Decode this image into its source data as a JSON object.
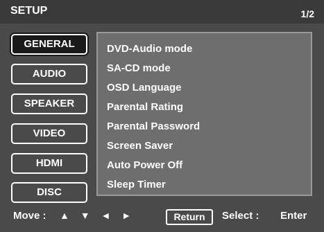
{
  "header": {
    "title": "SETUP",
    "page": "1/2"
  },
  "categories": [
    {
      "label": "GENERAL",
      "active": true
    },
    {
      "label": "AUDIO",
      "active": false
    },
    {
      "label": "SPEAKER",
      "active": false
    },
    {
      "label": "VIDEO",
      "active": false
    },
    {
      "label": "HDMI",
      "active": false
    },
    {
      "label": "DISC",
      "active": false
    }
  ],
  "menu": {
    "items": [
      "DVD-Audio mode",
      "SA-CD mode",
      "OSD Language",
      "Parental Rating",
      "Parental Password",
      "Screen Saver",
      "Auto Power Off",
      "Sleep Timer"
    ]
  },
  "footer": {
    "move_label": "Move :",
    "arrows": [
      "▲",
      "▼",
      "◄",
      "►"
    ],
    "return_label": "Return",
    "select_label": "Select :",
    "enter_label": "Enter"
  },
  "colors": {
    "background": "#4a4a4a",
    "panel": "#6e6e6e",
    "active_button": "#1a1a1a",
    "text": "#ffffff"
  }
}
